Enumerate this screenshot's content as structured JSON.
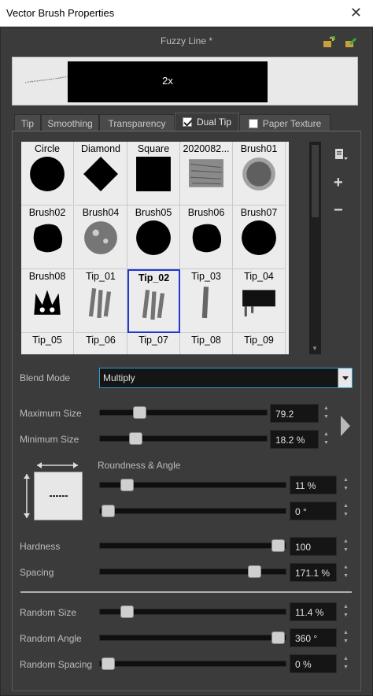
{
  "window": {
    "title": "Vector Brush Properties",
    "close": "✕"
  },
  "preset": {
    "name": "Fuzzy Line *"
  },
  "preview": {
    "zoom": "2x"
  },
  "tabs": [
    {
      "label": "Tip",
      "active": false
    },
    {
      "label": "Smoothing",
      "active": false
    },
    {
      "label": "Transparency",
      "active": false
    },
    {
      "label": "Dual Tip",
      "active": true,
      "checked": true
    },
    {
      "label": "Paper Texture",
      "active": false,
      "checked": false
    }
  ],
  "tips": [
    {
      "label": "Circle",
      "shape": "circle"
    },
    {
      "label": "Diamond",
      "shape": "diamond"
    },
    {
      "label": "Square",
      "shape": "square"
    },
    {
      "label": "2020082...",
      "shape": "texture"
    },
    {
      "label": "Brush01",
      "shape": "fuzzy-round"
    },
    {
      "label": "Brush02",
      "shape": "splat"
    },
    {
      "label": "Brush04",
      "shape": "spongy"
    },
    {
      "label": "Brush05",
      "shape": "rough-round"
    },
    {
      "label": "Brush06",
      "shape": "splat"
    },
    {
      "label": "Brush07",
      "shape": "rough-round"
    },
    {
      "label": "Brush08",
      "shape": "crown"
    },
    {
      "label": "Tip_01",
      "shape": "strokes"
    },
    {
      "label": "Tip_02",
      "shape": "strokes",
      "selected": true
    },
    {
      "label": "Tip_03",
      "shape": "thin-stroke"
    },
    {
      "label": "Tip_04",
      "shape": "block-stroke"
    },
    {
      "label": "Tip_05",
      "shape": "none"
    },
    {
      "label": "Tip_06",
      "shape": "none"
    },
    {
      "label": "Tip_07",
      "shape": "none"
    },
    {
      "label": "Tip_08",
      "shape": "none"
    },
    {
      "label": "Tip_09",
      "shape": "none"
    }
  ],
  "side_buttons": {
    "add": "+",
    "remove": "−"
  },
  "blend": {
    "label": "Blend Mode",
    "value": "Multiply"
  },
  "sliders": {
    "max_size": {
      "label": "Maximum Size",
      "value": "79.2",
      "level": 0.21
    },
    "min_size": {
      "label": "Minimum Size",
      "value": "18.2 %",
      "level": 0.18
    },
    "roundness_angle": {
      "label": "Roundness & Angle"
    },
    "roundness": {
      "value": "11 %",
      "level": 0.11
    },
    "angle": {
      "value": "0 °",
      "level": 0.0
    },
    "hardness": {
      "label": "Hardness",
      "value": "100",
      "level": 1.0
    },
    "spacing": {
      "label": "Spacing",
      "value": "171.1 %",
      "level": 0.86
    },
    "random_size": {
      "label": "Random Size",
      "value": "11.4 %",
      "level": 0.11
    },
    "random_angle": {
      "label": "Random Angle",
      "value": "360 °",
      "level": 1.0
    },
    "random_spacing": {
      "label": "Random Spacing",
      "value": "0 %",
      "level": 0.0
    }
  },
  "colors": {
    "accent": "#2f9fd0",
    "selection": "#2037d6",
    "panel": "#3b3b3b"
  }
}
